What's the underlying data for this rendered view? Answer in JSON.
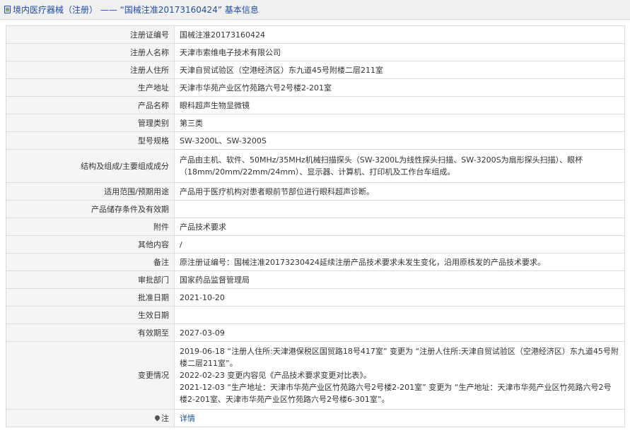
{
  "header": {
    "title": "境内医疗器械（注册） —— “国械注准20173160424” 基本信息"
  },
  "rows": [
    {
      "label": "注册证编号",
      "value": "国械注准20173160424"
    },
    {
      "label": "注册人名称",
      "value": "天津市索维电子技术有限公司"
    },
    {
      "label": "注册人住所",
      "value": "天津自贸试验区（空港经济区）东九道45号附楼二层211室"
    },
    {
      "label": "生产地址",
      "value": "天津市华苑产业区竹苑路六号2号楼2-201室"
    },
    {
      "label": "产品名称",
      "value": "眼科超声生物显微镜"
    },
    {
      "label": "管理类别",
      "value": "第三类"
    },
    {
      "label": "型号规格",
      "value": "SW-3200L、SW-3200S"
    },
    {
      "label": "结构及组成/主要组成成分",
      "value": "产品由主机、软件、50MHz/35MHz机械扫描探头（SW-3200L为线性探头扫描、SW-3200S为扇形探头扫描）、眼杯（18mm/20mm/22mm/24mm）、显示器、计算机、打印机及工作台车组成。"
    },
    {
      "label": "适用范围/预期用途",
      "value": "产品用于医疗机构对患者眼前节部位进行眼科超声诊断。"
    },
    {
      "label": "产品储存条件及有效期",
      "value": ""
    },
    {
      "label": "附件",
      "value": "产品技术要求"
    },
    {
      "label": "其他内容",
      "value": "/"
    },
    {
      "label": "备注",
      "value": "原注册证编号：国械注准20173230424延续注册产品技术要求未发生变化，沿用原核发的产品技术要求。"
    },
    {
      "label": "审批部门",
      "value": "国家药品监督管理局"
    },
    {
      "label": "批准日期",
      "value": "2021-10-20"
    },
    {
      "label": "生效日期",
      "value": ""
    },
    {
      "label": "有效期至",
      "value": "2027-03-09"
    }
  ],
  "changes": {
    "label": "变更情况",
    "lines": [
      "2019-06-18 “注册人住所:天津港保税区国贸路18号417室” 变更为 “注册人住所:天津自贸试验区（空港经济区）东九道45号附楼二层211室”。",
      "2022-02-23 变更内容见《产品技术要求变更对比表》。",
      "2021-12-03 “生产地址：天津市华苑产业区竹苑路六号2号楼2-201室” 变更为 “生产地址：天津市华苑产业区竹苑路六号2号楼2-201室、天津市华苑产业区竹苑路六号2号楼6-301室”。"
    ]
  },
  "note": {
    "label": "注",
    "link": "详情",
    "icon": "pin-icon"
  }
}
